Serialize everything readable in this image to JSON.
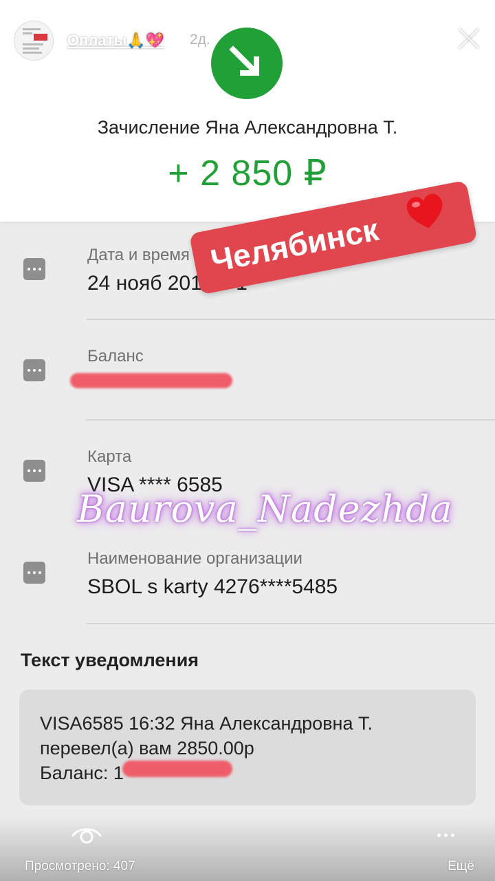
{
  "story": {
    "title": "Оплаты🙏💖",
    "time": "2д.",
    "progress": [
      1.0,
      0.17,
      0.0,
      0.0
    ]
  },
  "operation": {
    "title": "Зачисление Яна Александровна Т.",
    "amount": "+ 2 850 ₽",
    "amount_color": "#21a038"
  },
  "details": [
    {
      "label": "Дата и время операции",
      "value": "24 нояб 2019 в 1"
    },
    {
      "label": "Баланс",
      "value": ""
    },
    {
      "label": "Карта",
      "value": "VISA **** 6585"
    },
    {
      "label": "Наименование организации",
      "value": "SBOL s karty 4276****5485"
    }
  ],
  "stickers": {
    "city": "Челябинск",
    "watermark": "Baurova_Nadezhda"
  },
  "notification": {
    "title": "Текст уведомления",
    "lines": [
      "VISA6585 16:32 Яна Александровна Т.",
      "перевел(а) вам 2850.00р",
      "Баланс: 1"
    ]
  },
  "footer": {
    "views": "Просмотрено: 407",
    "more": "Ещё"
  },
  "icons": {
    "arrow": "arrow-down-right-icon",
    "eye": "eye-icon",
    "more": "more-dots-icon",
    "close": "close-icon",
    "menu": "row-menu-icon"
  }
}
